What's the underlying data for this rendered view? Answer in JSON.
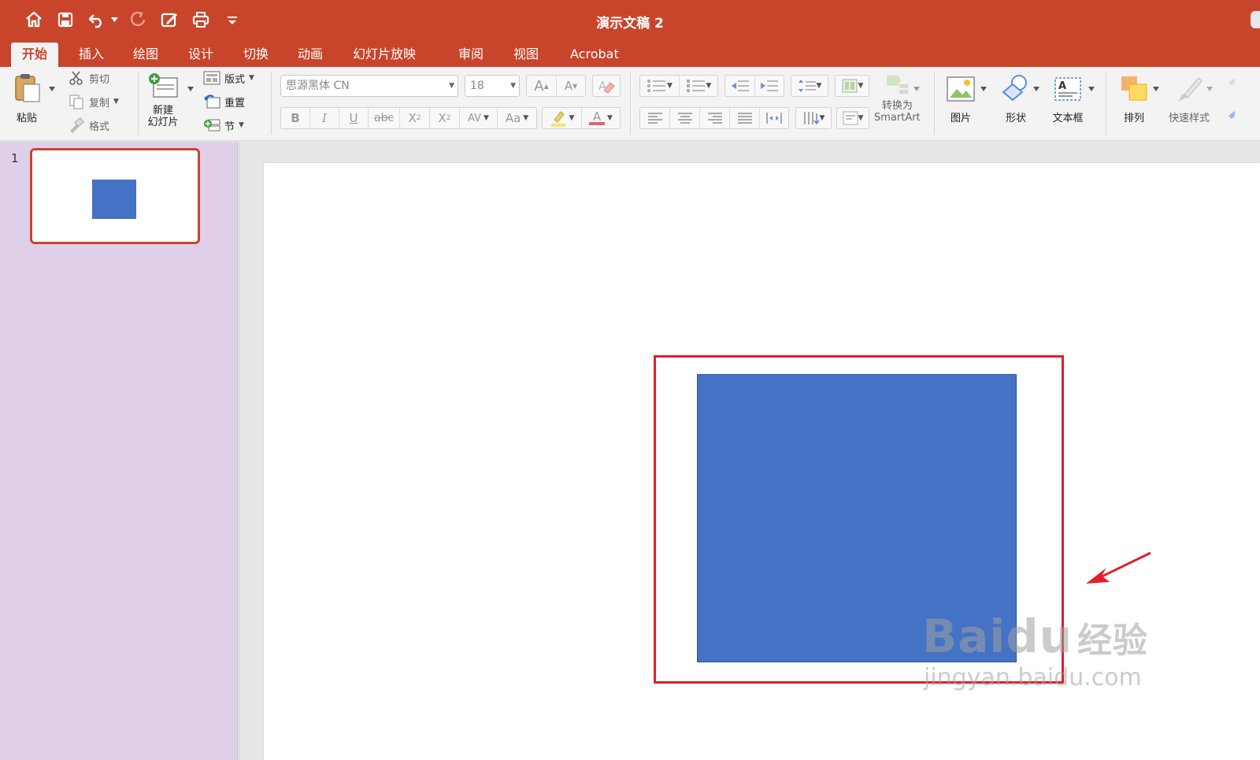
{
  "app": {
    "document_title": "演示文稿 2",
    "accent_color": "#c8452b"
  },
  "quick_access": [
    "home-icon",
    "save-icon",
    "undo-icon",
    "redo-icon",
    "edit-icon",
    "print-icon",
    "customize-icon"
  ],
  "tabs": [
    {
      "label": "开始",
      "active": true
    },
    {
      "label": "插入"
    },
    {
      "label": "绘图"
    },
    {
      "label": "设计"
    },
    {
      "label": "切换"
    },
    {
      "label": "动画"
    },
    {
      "label": "幻灯片放映"
    },
    {
      "label": "审阅"
    },
    {
      "label": "视图"
    },
    {
      "label": "Acrobat"
    }
  ],
  "ribbon": {
    "paste": "粘贴",
    "cut": "剪切",
    "copy": "复制",
    "format_painter": "格式",
    "new_slide_line1": "新建",
    "new_slide_line2": "幻灯片",
    "layout": "版式",
    "reset": "重置",
    "section": "节",
    "font_name": "思源黑体 CN",
    "font_size": "18",
    "increase_font": "A",
    "decrease_font": "A",
    "bold": "B",
    "italic": "I",
    "underline": "U",
    "strikethrough": "abc",
    "superscript": "X",
    "superscript_mark": "2",
    "subscript": "X",
    "subscript_mark": "2",
    "char_spacing": "AV",
    "change_case": "Aa",
    "font_color": "A",
    "smartart_line1": "转换为",
    "smartart_line2": "SmartArt",
    "picture": "图片",
    "shapes": "形状",
    "textbox": "文本框",
    "textbox_glyph": "A",
    "arrange": "排列",
    "quick_styles": "快速样式"
  },
  "thumbnails": [
    {
      "number": "1",
      "selected": true
    }
  ],
  "slide": {
    "shape_fill": "#4472c4",
    "annotation_color": "#e0202a"
  },
  "watermark": {
    "logo_text": "Bai",
    "logo_suffix": "du",
    "logo_cn": "经验",
    "url": "jingyan.baidu.com"
  }
}
